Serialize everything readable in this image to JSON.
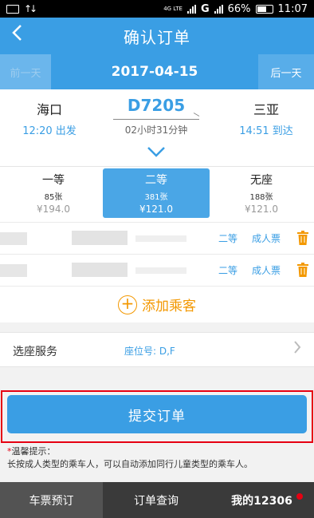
{
  "status_bar": {
    "network": "4G LTE",
    "carrier_g": "G",
    "battery": "66%",
    "time": "11:07"
  },
  "nav": {
    "back_icon": "back-arrow-icon",
    "title": "确认订单"
  },
  "date_bar": {
    "prev_label": "前一天",
    "date": "2017-04-15",
    "next_label": "后一天"
  },
  "train": {
    "from_station": "海口",
    "from_time": "12:20 出发",
    "number": "D7205",
    "duration": "02小时31分钟",
    "to_station": "三亚",
    "to_time": "14:51 到达",
    "expand_icon": "chevron-down-icon"
  },
  "seats": [
    {
      "type": "一等",
      "count": "85张",
      "price": "¥194.0",
      "selected": false
    },
    {
      "type": "二等",
      "count": "381张",
      "price": "¥121.0",
      "selected": true
    },
    {
      "type": "无座",
      "count": "188张",
      "price": "¥121.0",
      "selected": false
    }
  ],
  "passengers": [
    {
      "seat": "二等",
      "ticket_type": "成人票",
      "delete_icon": "trash-icon"
    },
    {
      "seat": "二等",
      "ticket_type": "成人票",
      "delete_icon": "trash-icon"
    }
  ],
  "add_passenger": {
    "icon": "plus-circle-icon",
    "label": "添加乘客"
  },
  "seat_service": {
    "label": "选座服务",
    "value": "座位号: D,F",
    "arrow_icon": "chevron-right-icon"
  },
  "submit": {
    "label": "提交订单"
  },
  "tips": {
    "marker": "*",
    "title": "温馨提示：",
    "text": "长按成人类型的乘车人，可以自动添加同行儿童类型的乘车人。"
  },
  "tab_bar": {
    "tabs": [
      {
        "label": "车票预订",
        "active": true
      },
      {
        "label": "订单查询",
        "active": false
      },
      {
        "label": "我的12306",
        "active": false,
        "badge": true
      }
    ]
  },
  "colors": {
    "primary": "#3a9ee4",
    "accent": "#f39800",
    "highlight_border": "#e60012"
  }
}
